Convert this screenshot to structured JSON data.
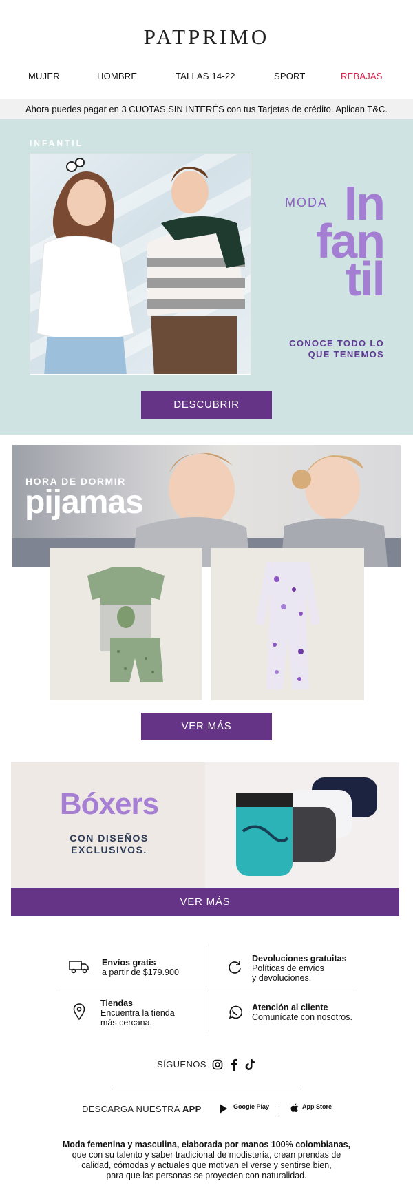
{
  "header": {
    "brand": "PATPRIMO",
    "nav": [
      {
        "label": "MUJER"
      },
      {
        "label": "HOMBRE"
      },
      {
        "label": "TALLAS 14-22"
      },
      {
        "label": "SPORT"
      },
      {
        "label": "REBAJAS",
        "color": "#d81f4b"
      }
    ],
    "promo": "Ahora puedes pagar en 3 CUOTAS SIN INTERÉS con tus Tarjetas de crédito. Aplican T&C."
  },
  "hero": {
    "tag": "INFANTIL",
    "moda": "MODA",
    "big_lines": [
      "In",
      "fan",
      "til"
    ],
    "subtitle_lines": [
      "CONOCE TODO LO",
      "QUE TENEMOS"
    ],
    "button": "DESCUBRIR",
    "bg_color": "#cfe3e2",
    "accent_color": "#a47ed3"
  },
  "pijamas": {
    "tag": "HORA DE DORMIR",
    "title": "pijamas",
    "button": "VER MÁS"
  },
  "boxers": {
    "title": "Bóxers",
    "subtitle_lines": [
      "CON DISEÑOS",
      "EXCLUSIVOS."
    ],
    "button": "VER MÁS"
  },
  "services": {
    "shipping": {
      "title": "Envíos gratis",
      "text": "a partir de  $179.900",
      "icon": "truck-icon"
    },
    "returns": {
      "title": "Devoluciones gratuitas",
      "text_lines": [
        "Políticas de envíos",
        "y devoluciones."
      ],
      "icon": "refresh-icon"
    },
    "stores": {
      "title": "Tiendas",
      "text_lines": [
        "Encuentra la tienda",
        "más cercana."
      ],
      "icon": "location-pin-icon"
    },
    "support": {
      "title": "Atención al cliente",
      "text": "Comunícate con nosotros.",
      "icon": "whatsapp-icon"
    }
  },
  "social": {
    "label": "SÍGUENOS",
    "icons": [
      "instagram-icon",
      "facebook-icon",
      "tiktok-icon"
    ]
  },
  "app": {
    "label_prefix": "DESCARGA NUESTRA ",
    "label_bold": "APP",
    "google_play": "Google Play",
    "app_store": "App Store"
  },
  "footer": {
    "bold_line": "Moda femenina y masculina, elaborada por manos 100% colombianas,",
    "lines": [
      "que con su talento y saber tradicional de modistería, crean prendas de",
      "calidad, cómodas y actuales que motivan el verse y sentirse bien,",
      "para que las personas se proyecten con naturalidad."
    ]
  },
  "colors": {
    "brand_purple": "#663487",
    "sale_red": "#d81f4b"
  }
}
